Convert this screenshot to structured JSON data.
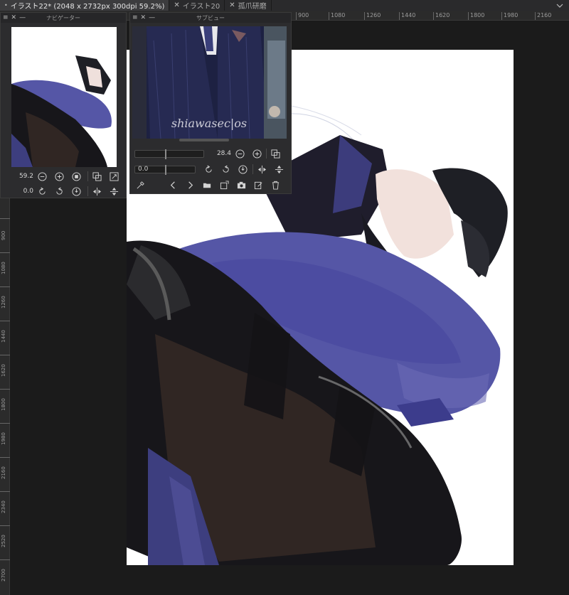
{
  "tabs": [
    {
      "label": "イラスト22* (2048 x 2732px 300dpi 59.2%)",
      "active": true,
      "prefix": "•"
    },
    {
      "label": "イラスト20",
      "active": false,
      "prefix": "✕"
    },
    {
      "label": "孤爪研磨",
      "active": false,
      "prefix": "✕"
    }
  ],
  "ruler": {
    "top_ticks": [
      "900",
      "1080",
      "1260",
      "1440",
      "1620",
      "1800",
      "1980",
      "2160"
    ],
    "left_ticks": [
      "900",
      "1080",
      "1260",
      "1440",
      "1620",
      "1800",
      "1980",
      "2160",
      "2340",
      "2520",
      "2700"
    ]
  },
  "navigator": {
    "title": "ナビゲーター",
    "zoom_value": "59.2",
    "rotation_value": "0.0"
  },
  "subview": {
    "title": "サブビュー",
    "zoom_value": "28.4",
    "rotation_value": "0.0",
    "watermark": "shiawasec|os"
  },
  "colors": {
    "background": "#1b1b1b",
    "panel": "#2c2c2e",
    "jacket_blue": "#4f4f9a",
    "pants_dark": "#2a2220",
    "canvas": "#ffffff"
  }
}
